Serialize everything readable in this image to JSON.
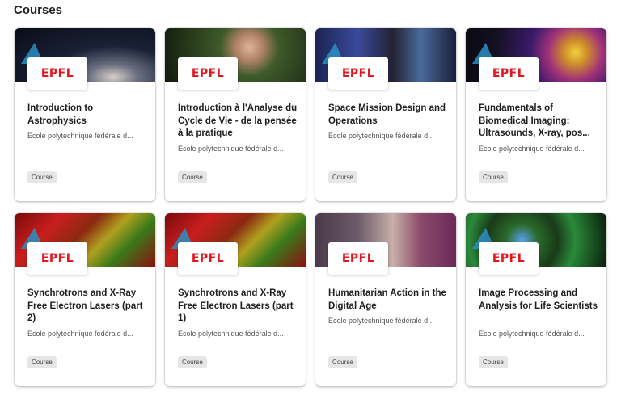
{
  "page": {
    "title": "Courses"
  },
  "brand": {
    "logo_text": "EPFL",
    "logo_color": "#e2161f",
    "accent": "#2a8fc4"
  },
  "courses": [
    {
      "title": "Introduction to Astrophysics",
      "partner": "École polytechnique fédérale d...",
      "type": "Course"
    },
    {
      "title": "Introduction à l'Analyse du Cycle de Vie - de la pensée à la pratique",
      "partner": "École polytechnique fédérale d...",
      "type": "Course"
    },
    {
      "title": "Space Mission Design and Operations",
      "partner": "École polytechnique fédérale d...",
      "type": "Course"
    },
    {
      "title": "Fundamentals of Biomedical Imaging: Ultrasounds, X-ray, pos...",
      "partner": "École polytechnique fédérale d...",
      "type": "Course"
    },
    {
      "title": "Synchrotrons and X-Ray Free Electron Lasers (part 2)",
      "partner": "École polytechnique fédérale d...",
      "type": "Course"
    },
    {
      "title": "Synchrotrons and X-Ray Free Electron Lasers (part 1)",
      "partner": "École polytechnique fédérale d...",
      "type": "Course"
    },
    {
      "title": "Humanitarian Action in the Digital Age",
      "partner": "École polytechnique fédérale d...",
      "type": "Course"
    },
    {
      "title": "Image Processing and Analysis for Life Scientists",
      "partner": "École polytechnique fédérale d...",
      "type": "Course"
    }
  ]
}
